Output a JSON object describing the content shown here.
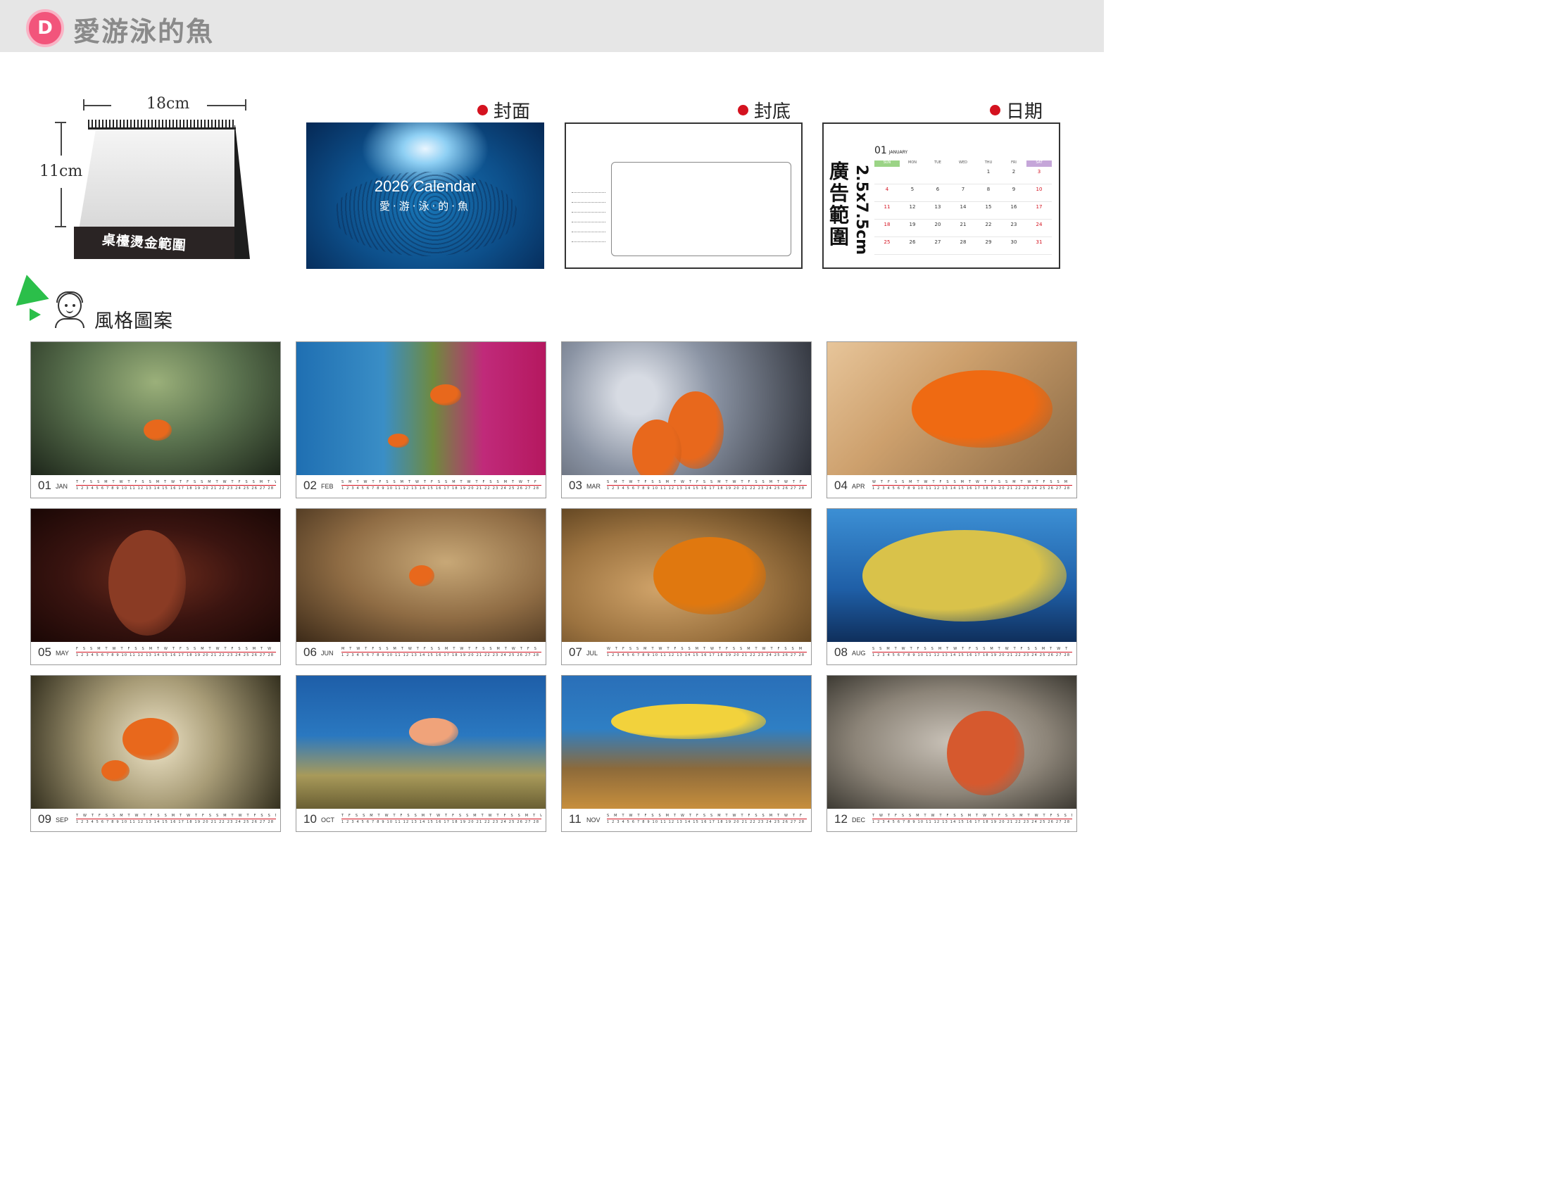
{
  "header": {
    "badge": "D",
    "title": "愛游泳的魚"
  },
  "desk": {
    "width_label": "18cm",
    "height_label": "11cm",
    "band_label": "桌檯燙金範圍"
  },
  "panels": {
    "cover": {
      "tag": "封面",
      "title": "2026 Calendar",
      "subtitle": "愛·游·泳·的·魚"
    },
    "back": {
      "tag": "封底"
    },
    "date": {
      "tag": "日期",
      "ad_text": "廣告範圍",
      "ad_size": "2.5x7.5cm",
      "month_num": "01",
      "month_name": "JANUARY",
      "weekdays": [
        "SUN",
        "MON",
        "TUE",
        "WED",
        "THU",
        "FRI",
        "SAT"
      ],
      "rows": [
        [
          "",
          "",
          "",
          "",
          "1",
          "2",
          "3"
        ],
        [
          "4",
          "5",
          "6",
          "7",
          "8",
          "9",
          "10"
        ],
        [
          "11",
          "12",
          "13",
          "14",
          "15",
          "16",
          "17"
        ],
        [
          "18",
          "19",
          "20",
          "21",
          "22",
          "23",
          "24"
        ],
        [
          "25",
          "26",
          "27",
          "28",
          "29",
          "30",
          "31"
        ]
      ]
    }
  },
  "styles_label": "風格圖案",
  "months": [
    {
      "num": "01",
      "name": "JAN",
      "wd": "T F S S M T W T F S S M T W T F S S M T W T F S S M T W T F S",
      "days": "1 2 3 4 5 6 7 8 9 10 11 12 13 14 15 16 17 18 19 20 21 22 23 24 25 26 27 28 29 30 31"
    },
    {
      "num": "02",
      "name": "FEB",
      "wd": "S M T W T F S S M T W T F S S M T W T F S S M T W T F S",
      "days": "1 2 3 4 5 6 7 8 9 10 11 12 13 14 15 16 17 18 19 20 21 22 23 24 25 26 27 28"
    },
    {
      "num": "03",
      "name": "MAR",
      "wd": "S M T W T F S S M T W T F S S M T W T F S S M T W T F S S M T",
      "days": "1 2 3 4 5 6 7 8 9 10 11 12 13 14 15 16 17 18 19 20 21 22 23 24 25 26 27 28 29 30 31"
    },
    {
      "num": "04",
      "name": "APR",
      "wd": "W T F S S M T W T F S S M T W T F S S M T W T F S S M T W T",
      "days": "1 2 3 4 5 6 7 8 9 10 11 12 13 14 15 16 17 18 19 20 21 22 23 24 25 26 27 28 29 30"
    },
    {
      "num": "05",
      "name": "MAY",
      "wd": "F S S M T W T F S S M T W T F S S M T W T F S S M T W T F S S",
      "days": "1 2 3 4 5 6 7 8 9 10 11 12 13 14 15 16 17 18 19 20 21 22 23 24 25 26 27 28 29 30 31"
    },
    {
      "num": "06",
      "name": "JUN",
      "wd": "M T W T F S S M T W T F S S M T W T F S S M T W T F S S M T",
      "days": "1 2 3 4 5 6 7 8 9 10 11 12 13 14 15 16 17 18 19 20 21 22 23 24 25 26 27 28 29 30"
    },
    {
      "num": "07",
      "name": "JUL",
      "wd": "W T F S S M T W T F S S M T W T F S S M T W T F S S M T W T F",
      "days": "1 2 3 4 5 6 7 8 9 10 11 12 13 14 15 16 17 18 19 20 21 22 23 24 25 26 27 28 29 30 31"
    },
    {
      "num": "08",
      "name": "AUG",
      "wd": "S S M T W T F S S M T W T F S S M T W T F S S M T W T F S S M",
      "days": "1 2 3 4 5 6 7 8 9 10 11 12 13 14 15 16 17 18 19 20 21 22 23 24 25 26 27 28 29 30 31"
    },
    {
      "num": "09",
      "name": "SEP",
      "wd": "T W T F S S M T W T F S S M T W T F S S M T W T F S S M T W",
      "days": "1 2 3 4 5 6 7 8 9 10 11 12 13 14 15 16 17 18 19 20 21 22 23 24 25 26 27 28 29 30"
    },
    {
      "num": "10",
      "name": "OCT",
      "wd": "T F S S M T W T F S S M T W T F S S M T W T F S S M T W T F S",
      "days": "1 2 3 4 5 6 7 8 9 10 11 12 13 14 15 16 17 18 19 20 21 22 23 24 25 26 27 28 29 30 31"
    },
    {
      "num": "11",
      "name": "NOV",
      "wd": "S M T W T F S S M T W T F S S M T W T F S S M T W T F S S M",
      "days": "1 2 3 4 5 6 7 8 9 10 11 12 13 14 15 16 17 18 19 20 21 22 23 24 25 26 27 28 29 30"
    },
    {
      "num": "12",
      "name": "DEC",
      "wd": "T W T F S S M T W T F S S M T W T F S S M T W T F S S M T W T",
      "days": "1 2 3 4 5 6 7 8 9 10 11 12 13 14 15 16 17 18 19 20 21 22 23 24 25 26 27 28 29 30 31"
    }
  ],
  "colors": {
    "accent_red": "#d4121f",
    "badge_pink": "#f2557b",
    "arrow_green": "#2bbf4a"
  }
}
